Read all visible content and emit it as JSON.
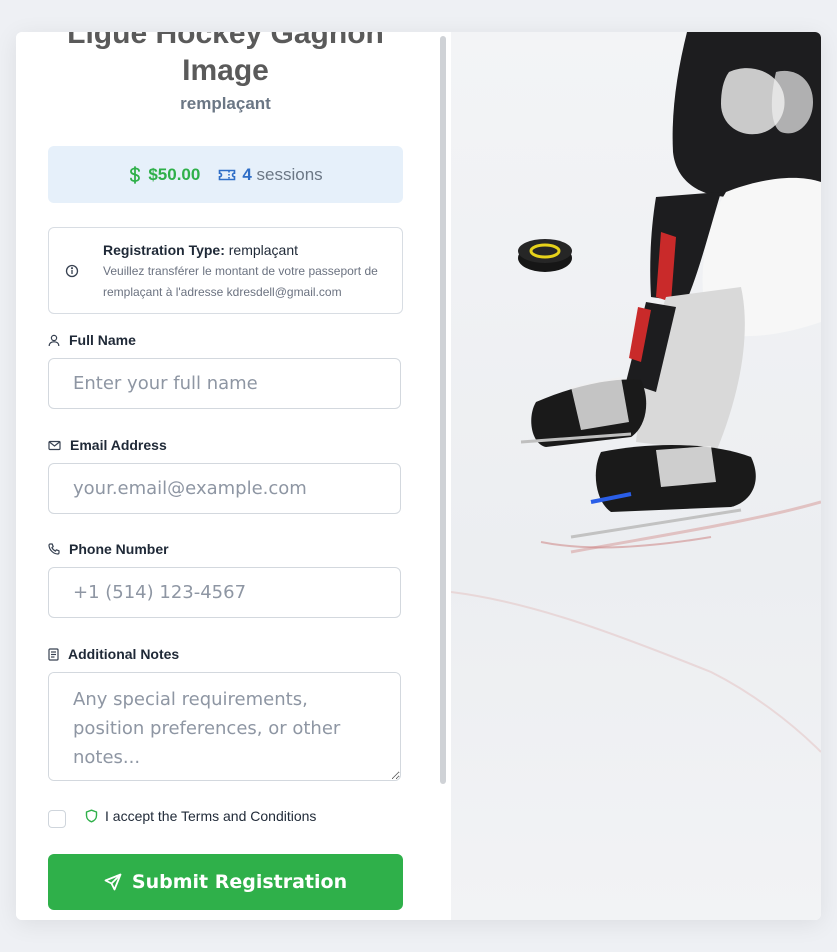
{
  "header": {
    "title_line1": "Ligue Hockey Gagnon",
    "title_line2": "Image",
    "subtitle": "remplaçant"
  },
  "pricing": {
    "amount": "$50.00",
    "sessions_count": "4",
    "sessions_label": "sessions",
    "price_color": "#2fb04a",
    "sessions_color": "#2f6ec7"
  },
  "info": {
    "type_label": "Registration Type:",
    "type_value": "remplaçant",
    "message": "Veuillez transférer le montant de votre passeport de remplaçant à l'adresse kdresdell@gmail.com"
  },
  "form": {
    "full_name": {
      "label": "Full Name",
      "placeholder": "Enter your full name",
      "icon": "user-icon"
    },
    "email": {
      "label": "Email Address",
      "placeholder": "your.email@example.com",
      "icon": "mail-icon"
    },
    "phone": {
      "label": "Phone Number",
      "placeholder": "+1 (514) 123-4567",
      "icon": "phone-icon"
    },
    "notes": {
      "label": "Additional Notes",
      "placeholder": "Any special requirements, position preferences, or other notes...",
      "icon": "notes-icon"
    },
    "terms_label": "I accept the Terms and Conditions",
    "submit_label": "Submit Registration"
  },
  "colors": {
    "accent": "#2fb04a",
    "info_bg": "#e6f0fa",
    "title": "#5a5a5a"
  },
  "hero_image": {
    "icon": "hockey-player-image"
  }
}
